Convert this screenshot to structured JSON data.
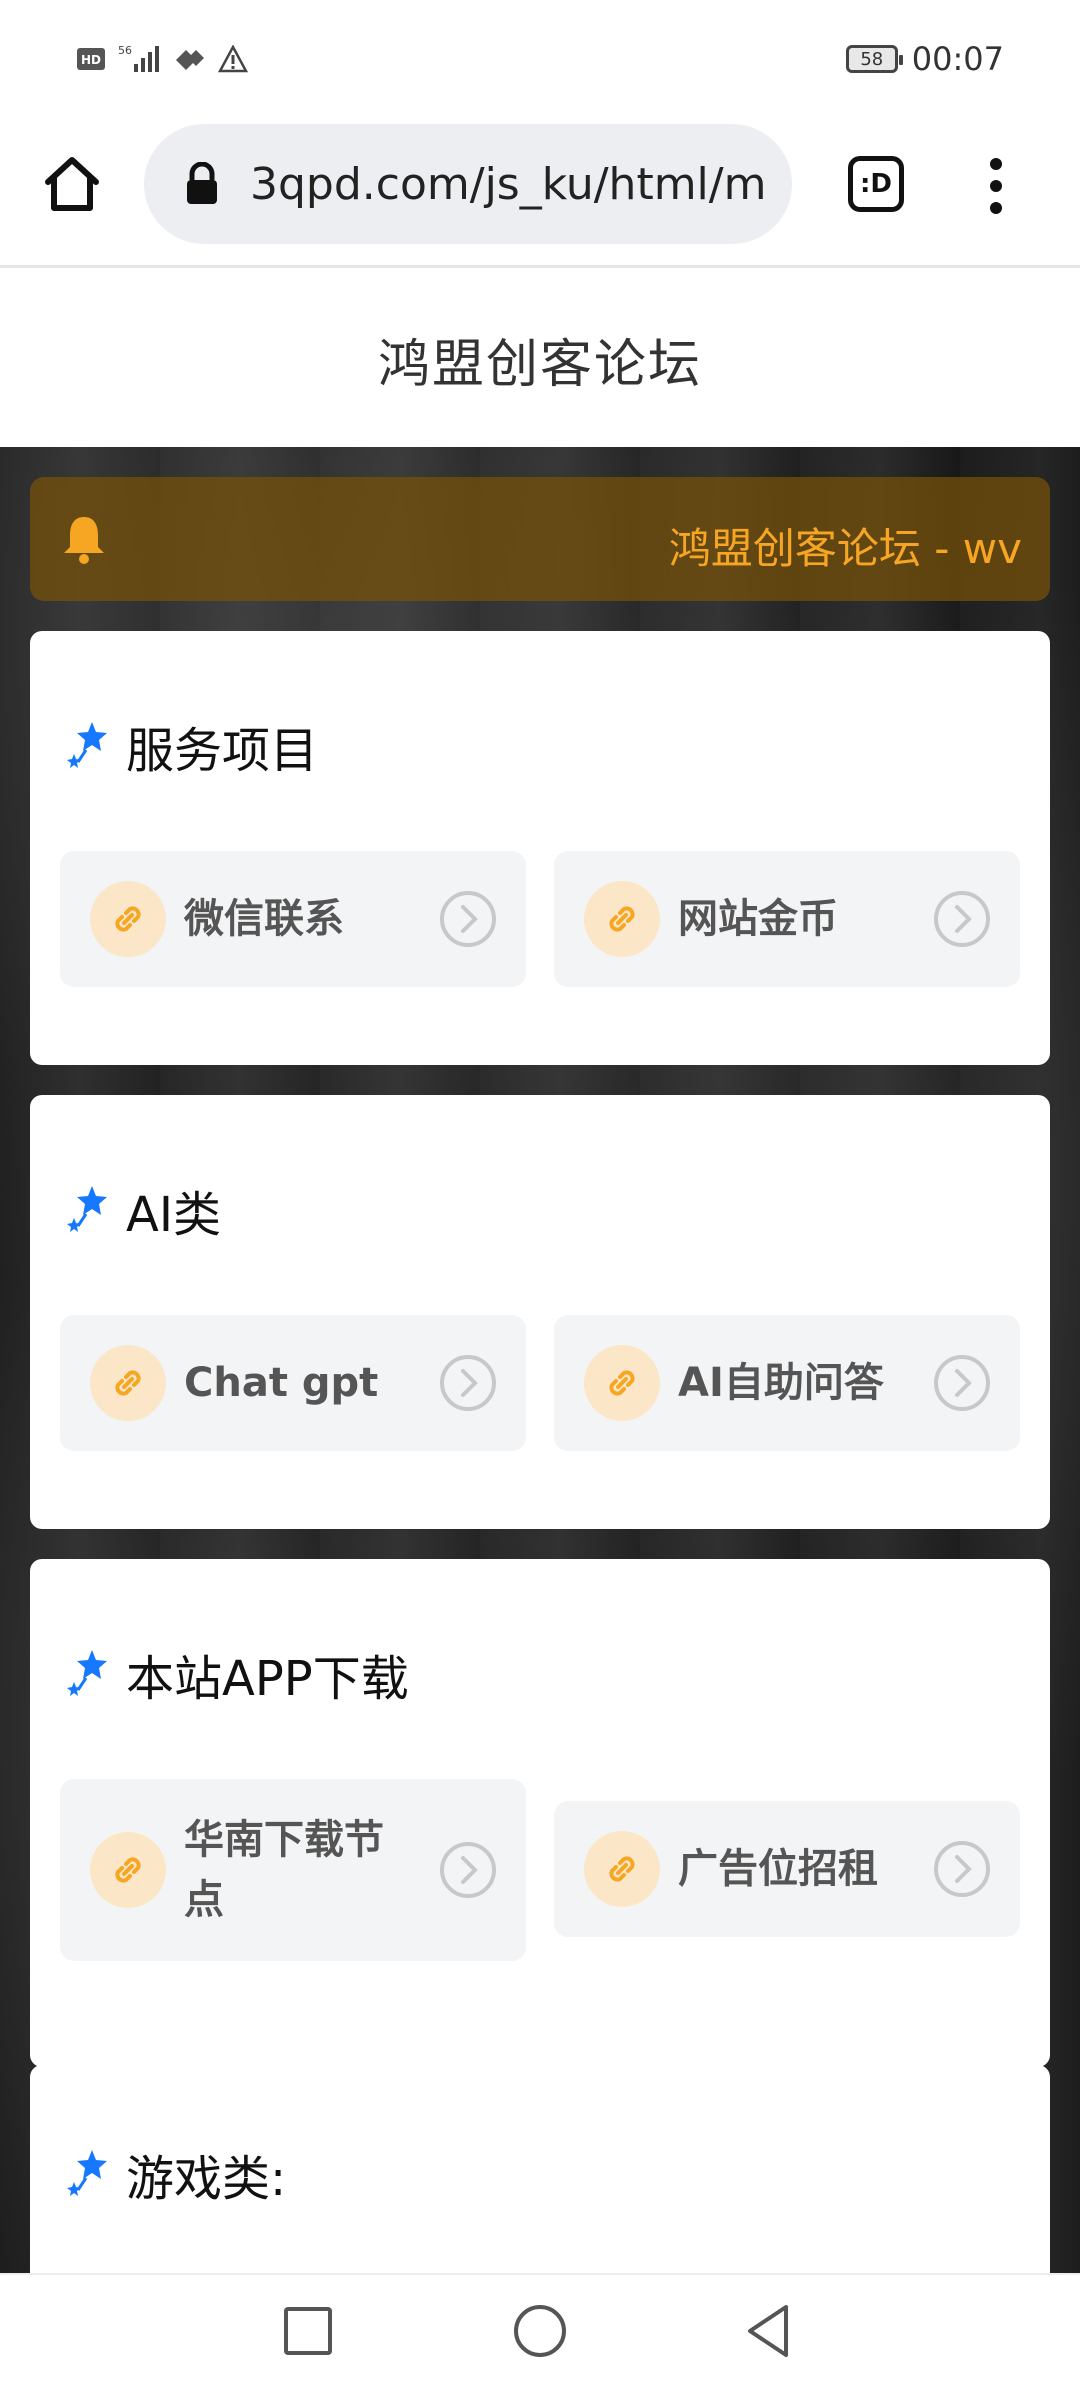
{
  "status": {
    "time": "00:07",
    "battery": "58",
    "network": "56"
  },
  "browser": {
    "url": "3qpd.com/js_ku/html/m",
    "tabs_label": ":D"
  },
  "site": {
    "title": "鸿盟创客论坛"
  },
  "notice": {
    "text": "鸿盟创客论坛 - wv"
  },
  "sections": [
    {
      "title": "服务项目",
      "items": [
        "微信联系",
        "网站金币"
      ]
    },
    {
      "title": "AI类",
      "items": [
        "Chat gpt",
        "AI自助问答"
      ]
    },
    {
      "title": "本站APP下载",
      "items": [
        "华南下载节点",
        "广告位招租"
      ]
    },
    {
      "title": "游戏类:",
      "items": []
    }
  ],
  "colors": {
    "accent": "#f6a623",
    "icon_blue": "#1677ff",
    "notice_bg": "#78520a"
  }
}
